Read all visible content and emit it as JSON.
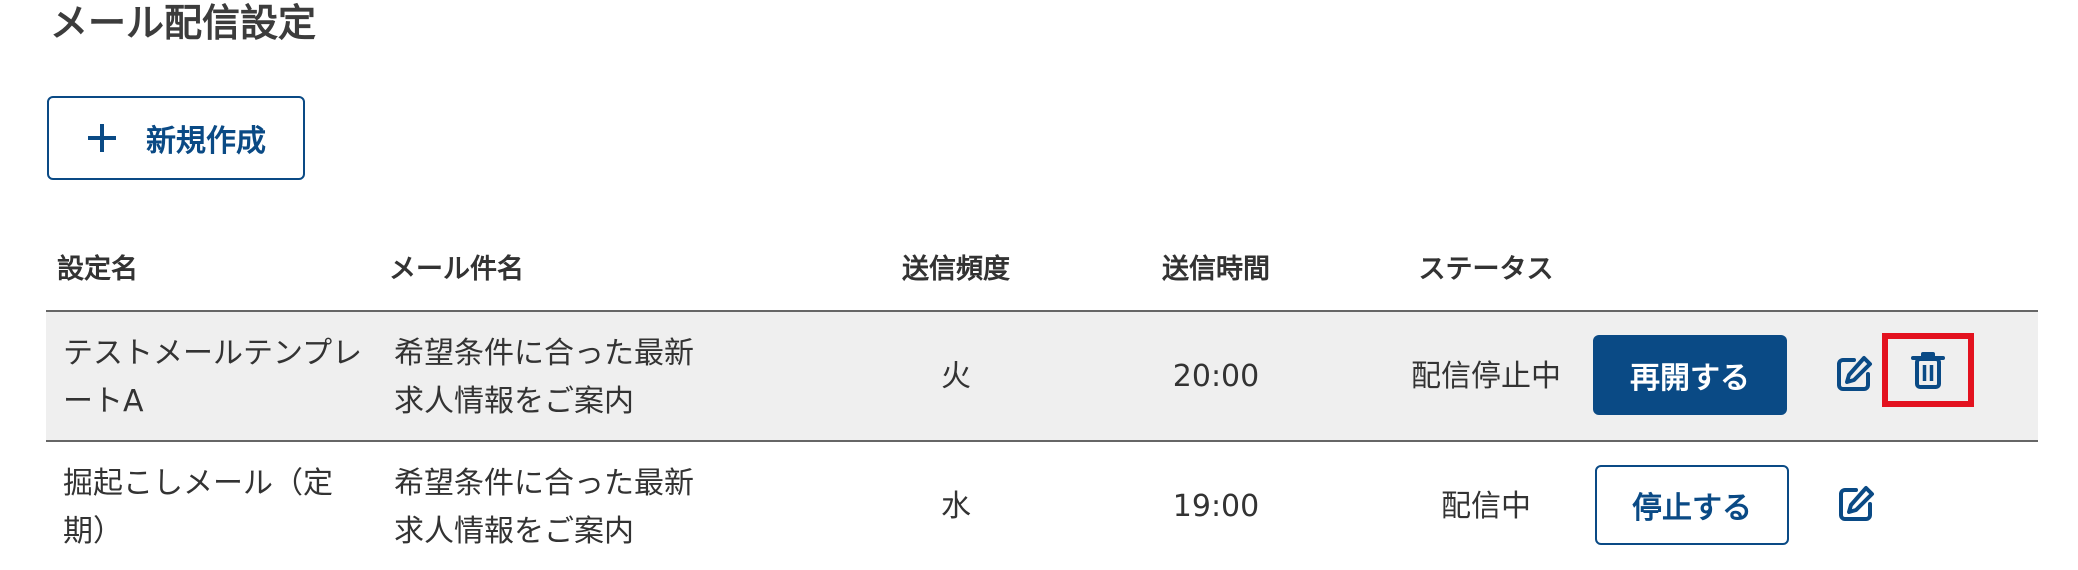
{
  "page": {
    "title": "メール配信設定"
  },
  "toolbar": {
    "new_label": "新規作成"
  },
  "table": {
    "headers": [
      "設定名",
      "メール件名",
      "送信頻度",
      "送信時間",
      "ステータス"
    ],
    "rows": [
      {
        "name": "テストメールテンプレートA",
        "subject": "希望条件に合った最新求人情報をご案内",
        "frequency": "火",
        "time": "20:00",
        "status": "配信停止中",
        "action_label": "再開する",
        "highlighted": true
      },
      {
        "name": "掘起こしメール（定期）",
        "subject": "希望条件に合った最新求人情報をご案内",
        "frequency": "水",
        "time": "19:00",
        "status": "配信中",
        "action_label": "停止する",
        "highlighted": false
      }
    ]
  },
  "icons": {
    "add": "plus-icon",
    "edit": "pencil-square-icon",
    "delete": "trash-icon"
  },
  "colors": {
    "primary": "#0a4a85",
    "highlight_row": "#efefef",
    "delete_focus_border": "#e3121f"
  }
}
